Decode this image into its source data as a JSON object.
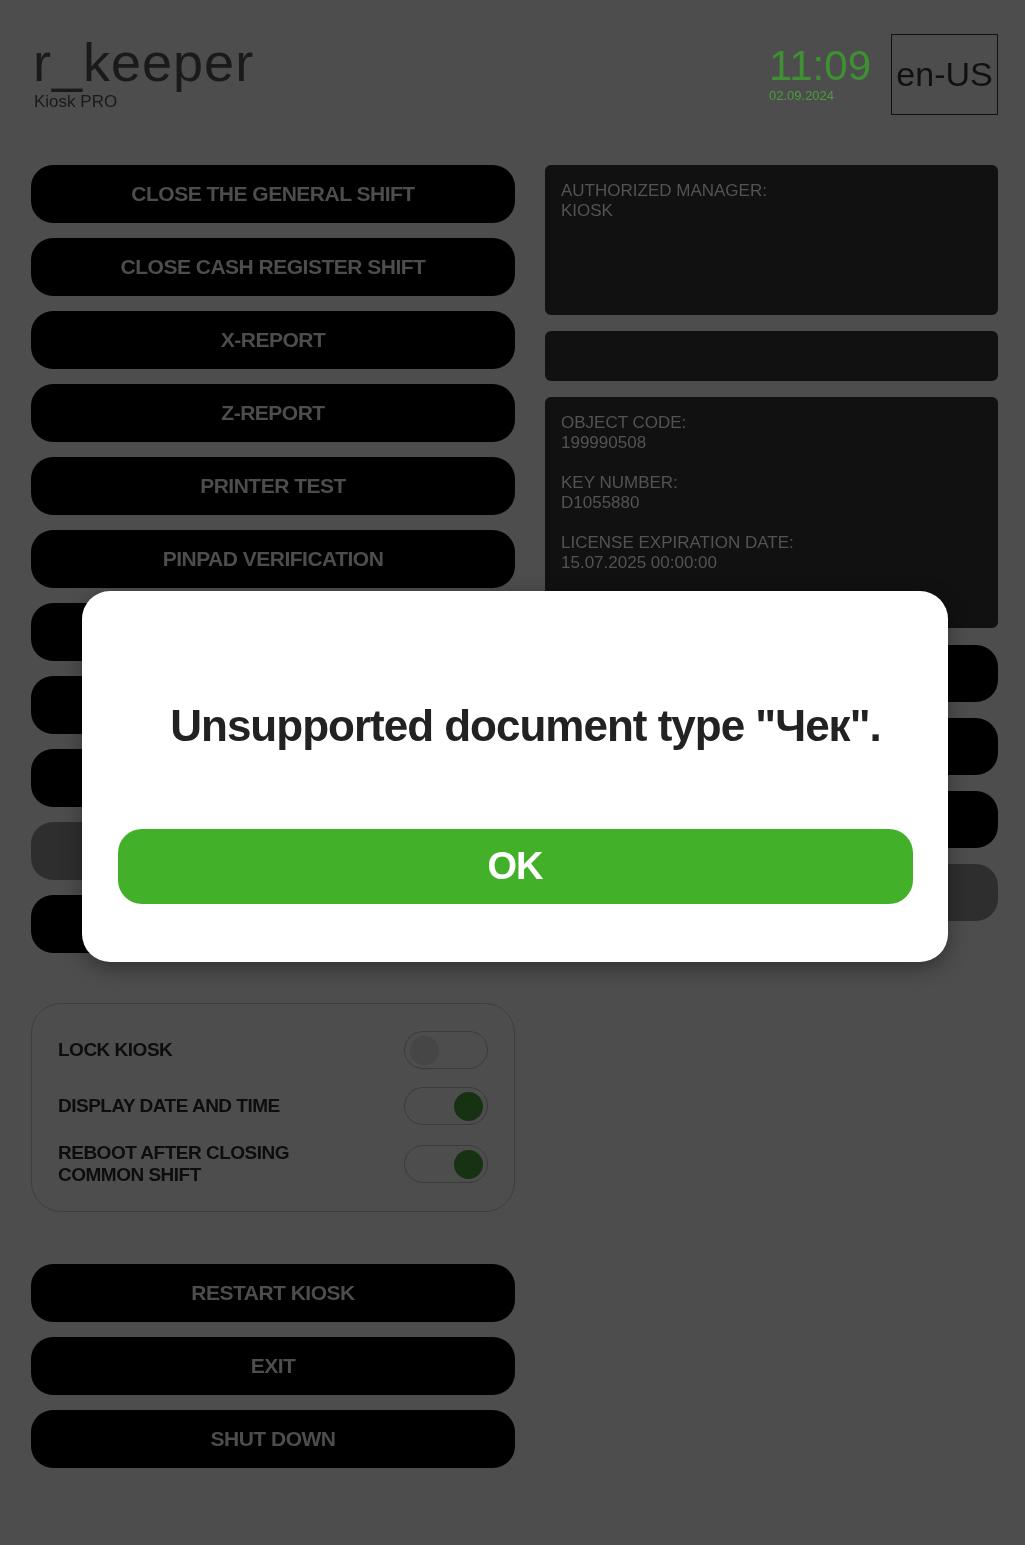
{
  "header": {
    "logo": "r_keeper",
    "subtitle": "Kiosk PRO",
    "time": "11:09",
    "date": "02.09.2024",
    "language": "en-US"
  },
  "actions": [
    {
      "label": "CLOSE THE GENERAL SHIFT",
      "disabled": false
    },
    {
      "label": "CLOSE CASH REGISTER SHIFT",
      "disabled": false
    },
    {
      "label": "X-REPORT",
      "disabled": false
    },
    {
      "label": "Z-REPORT",
      "disabled": false
    },
    {
      "label": "PRINTER TEST",
      "disabled": false
    },
    {
      "label": "PINPAD VERIFICATION",
      "disabled": false
    },
    {
      "disabled": false
    },
    {
      "disabled": false
    },
    {
      "disabled": false
    },
    {
      "disabled": true
    },
    {
      "disabled": false
    }
  ],
  "info_panels": [
    {
      "fields": [
        {
          "label": "AUTHORIZED MANAGER:",
          "value": "KIOSK"
        }
      ]
    },
    {
      "kind": "blank"
    },
    {
      "fields": [
        {
          "label": "OBJECT CODE:",
          "value": "199990508"
        },
        {
          "label": "KEY NUMBER:",
          "value": "D1055880"
        },
        {
          "label": "LICENSE EXPIRATION DATE:",
          "value": "15.07.2025 00:00:00"
        }
      ]
    }
  ],
  "side_buttons": [
    {
      "disabled": false
    },
    {
      "disabled": false
    },
    {
      "disabled": false
    },
    {
      "disabled": true
    }
  ],
  "settings": [
    {
      "label": "LOCK KIOSK",
      "on": false
    },
    {
      "label": "DISPLAY DATE AND TIME",
      "on": true
    },
    {
      "label": "REBOOT AFTER CLOSING COMMON SHIFT",
      "on": true
    }
  ],
  "bottom_buttons": [
    "RESTART KIOSK",
    "EXIT",
    "SHUT DOWN"
  ],
  "dialog": {
    "message": "Unsupported document type \"Чек\".",
    "button": "OK"
  }
}
